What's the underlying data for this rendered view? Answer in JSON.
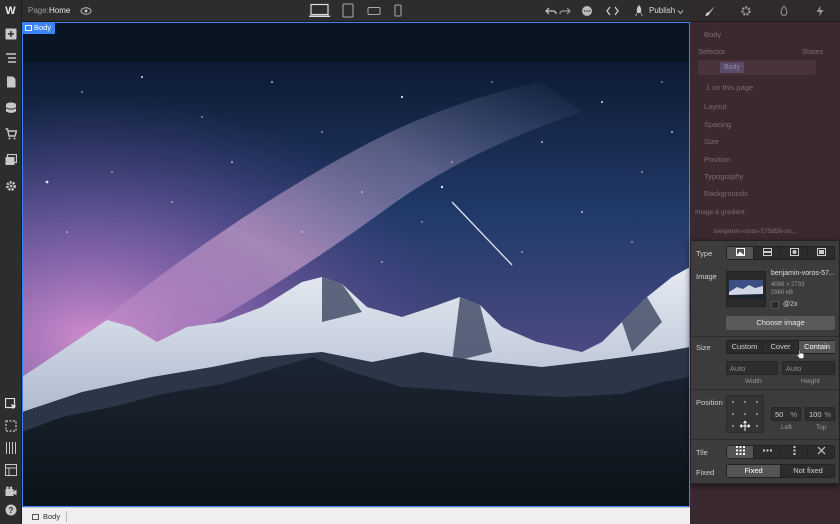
{
  "topbar": {
    "logo": "W",
    "page_label": "Page:",
    "page_name": "Home",
    "publish_label": "Publish"
  },
  "canvas": {
    "selected_element_tag": "Body"
  },
  "breadcrumb": {
    "items": [
      "Body"
    ]
  },
  "right_panel": {
    "element_name": "Body",
    "selector_label": "Selector",
    "states_label": "States",
    "selector_token": "Body",
    "on_page_note": "1 on this page",
    "sections": [
      "Layout",
      "Spacing",
      "Size",
      "Position",
      "Typography",
      "Backgrounds"
    ],
    "backgrounds_subheader": "Image & gradient",
    "background_layer_name": "benjamin-voros-575856-un..."
  },
  "background_popover": {
    "type_label": "Type",
    "image_label": "Image",
    "image_filename": "benjamin-voros-57...",
    "image_dimensions": "4096 × 2733",
    "image_filesize": "2960 kB",
    "retina_label": "@2x",
    "choose_image_label": "Choose image",
    "size_label": "Size",
    "size_options": [
      "Custom",
      "Cover",
      "Contain"
    ],
    "size_selected": "Contain",
    "width_value": "Auto",
    "height_value": "Auto",
    "width_label": "Width",
    "height_label": "Height",
    "position_label": "Position",
    "left_value": "50",
    "left_unit": "%",
    "top_value": "100",
    "top_unit": "%",
    "left_label": "Left",
    "top_label": "Top",
    "tile_label": "Tile",
    "fixed_label": "Fixed",
    "fixed_options": [
      "Fixed",
      "Not fixed"
    ],
    "fixed_selected": "Fixed"
  },
  "colors": {
    "selection_blue": "#3a82f7",
    "panel_bg": "#2d2d2d",
    "popover_bg": "#3c3c3c"
  }
}
